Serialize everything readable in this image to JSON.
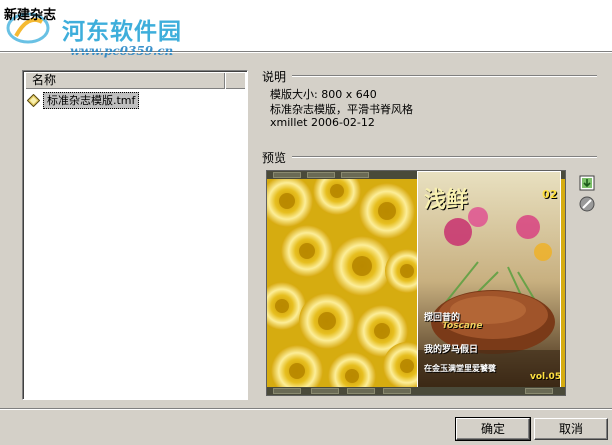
{
  "dialog": {
    "title": "新建杂志"
  },
  "watermark": {
    "title": "河东软件园",
    "url": "www.pc0359.cn"
  },
  "list": {
    "column_name": "名称",
    "items": [
      {
        "label": "标准杂志模版.tmf",
        "icon": "diamond-icon"
      }
    ]
  },
  "description": {
    "heading": "说明",
    "lines": [
      "模版大小: 800 x 640",
      "标准杂志模版，平滑书脊风格",
      "xmillet 2006-02-12"
    ]
  },
  "preview": {
    "heading": "预览",
    "cover": {
      "headline": "浅鲜",
      "issue": "02",
      "story1": "搅回昔的",
      "story1_en": "Toscane",
      "story2": "我的罗马假日",
      "story3": "在金玉满堂里爱饕餮",
      "vol": "vol.05"
    }
  },
  "buttons": {
    "ok": "确定",
    "cancel": "取消"
  },
  "colors": {
    "face": "#d4d0c8",
    "accent": "#2aa6d8"
  }
}
